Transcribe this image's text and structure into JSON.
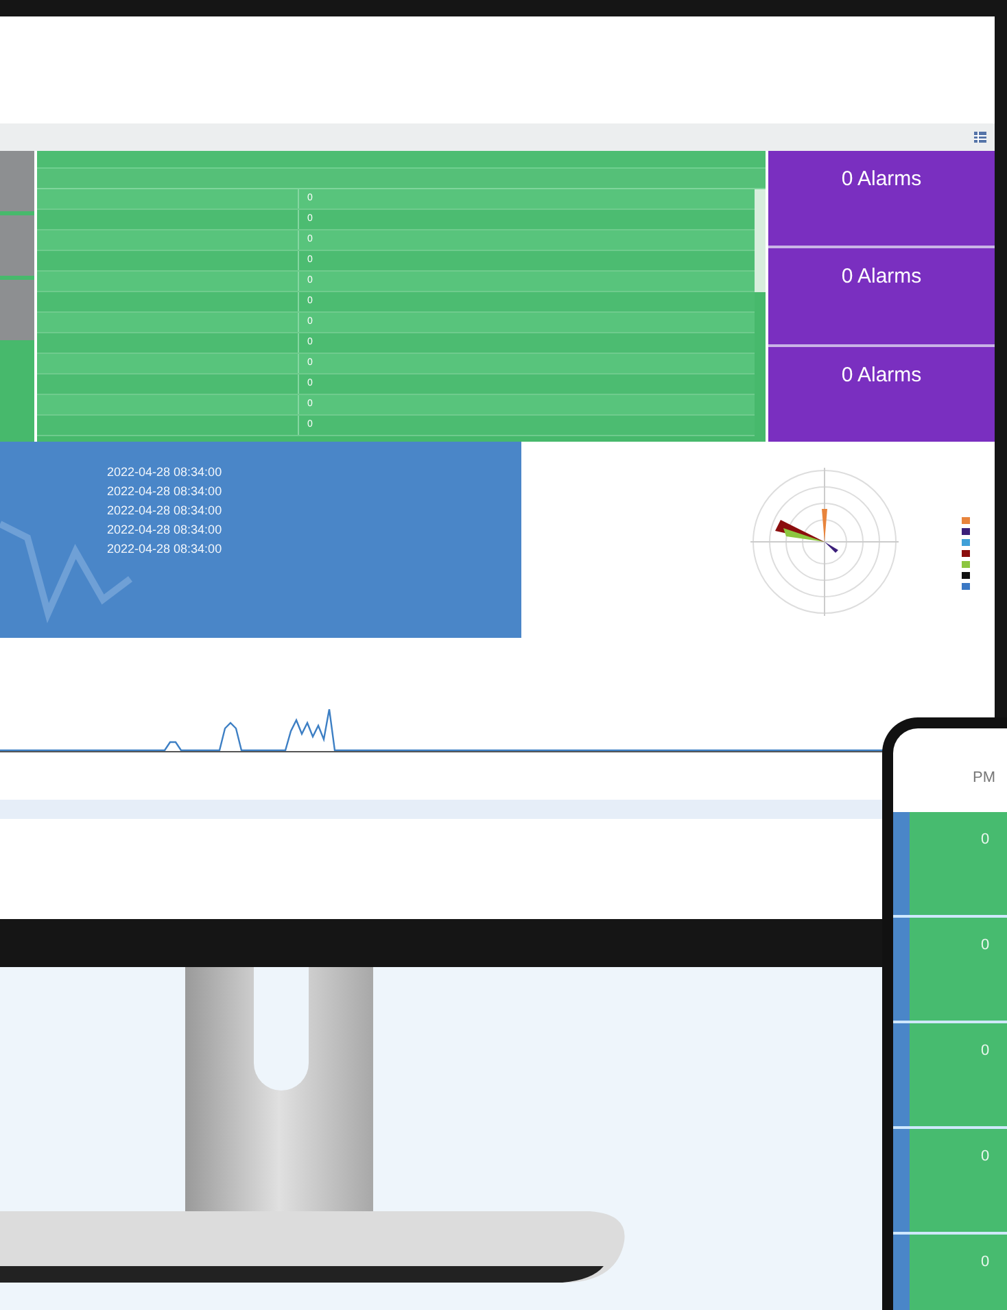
{
  "table": {
    "rows": [
      {
        "value": "0"
      },
      {
        "value": "0"
      },
      {
        "value": "0"
      },
      {
        "value": "0"
      },
      {
        "value": "0"
      },
      {
        "value": "0"
      },
      {
        "value": "0"
      },
      {
        "value": "0"
      },
      {
        "value": "0"
      },
      {
        "value": "0"
      },
      {
        "value": "0"
      },
      {
        "value": "0"
      }
    ]
  },
  "alarm_cards": [
    {
      "count": "0 Alarms"
    },
    {
      "count": "0 Alarms"
    },
    {
      "count": "0 Alarms"
    }
  ],
  "weather": {
    "times": [
      "2022-04-28 08:34:00",
      "2022-04-28 08:34:00",
      "2022-04-28 08:34:00",
      "2022-04-28 08:34:00",
      "2022-04-28 08:34:00"
    ]
  },
  "wind_rose": {
    "legend": [
      {
        "color": "#e8843c"
      },
      {
        "color": "#3b1f7a"
      },
      {
        "color": "#3fa0d8"
      },
      {
        "color": "#8b0d0d"
      },
      {
        "color": "#8cc63f"
      },
      {
        "color": "#111111"
      },
      {
        "color": "#3b78c4"
      }
    ]
  },
  "phone": {
    "title": "PM",
    "cards": [
      {
        "value": "0"
      },
      {
        "value": "0"
      },
      {
        "value": "0"
      },
      {
        "value": "0"
      },
      {
        "value": "0"
      }
    ]
  }
}
